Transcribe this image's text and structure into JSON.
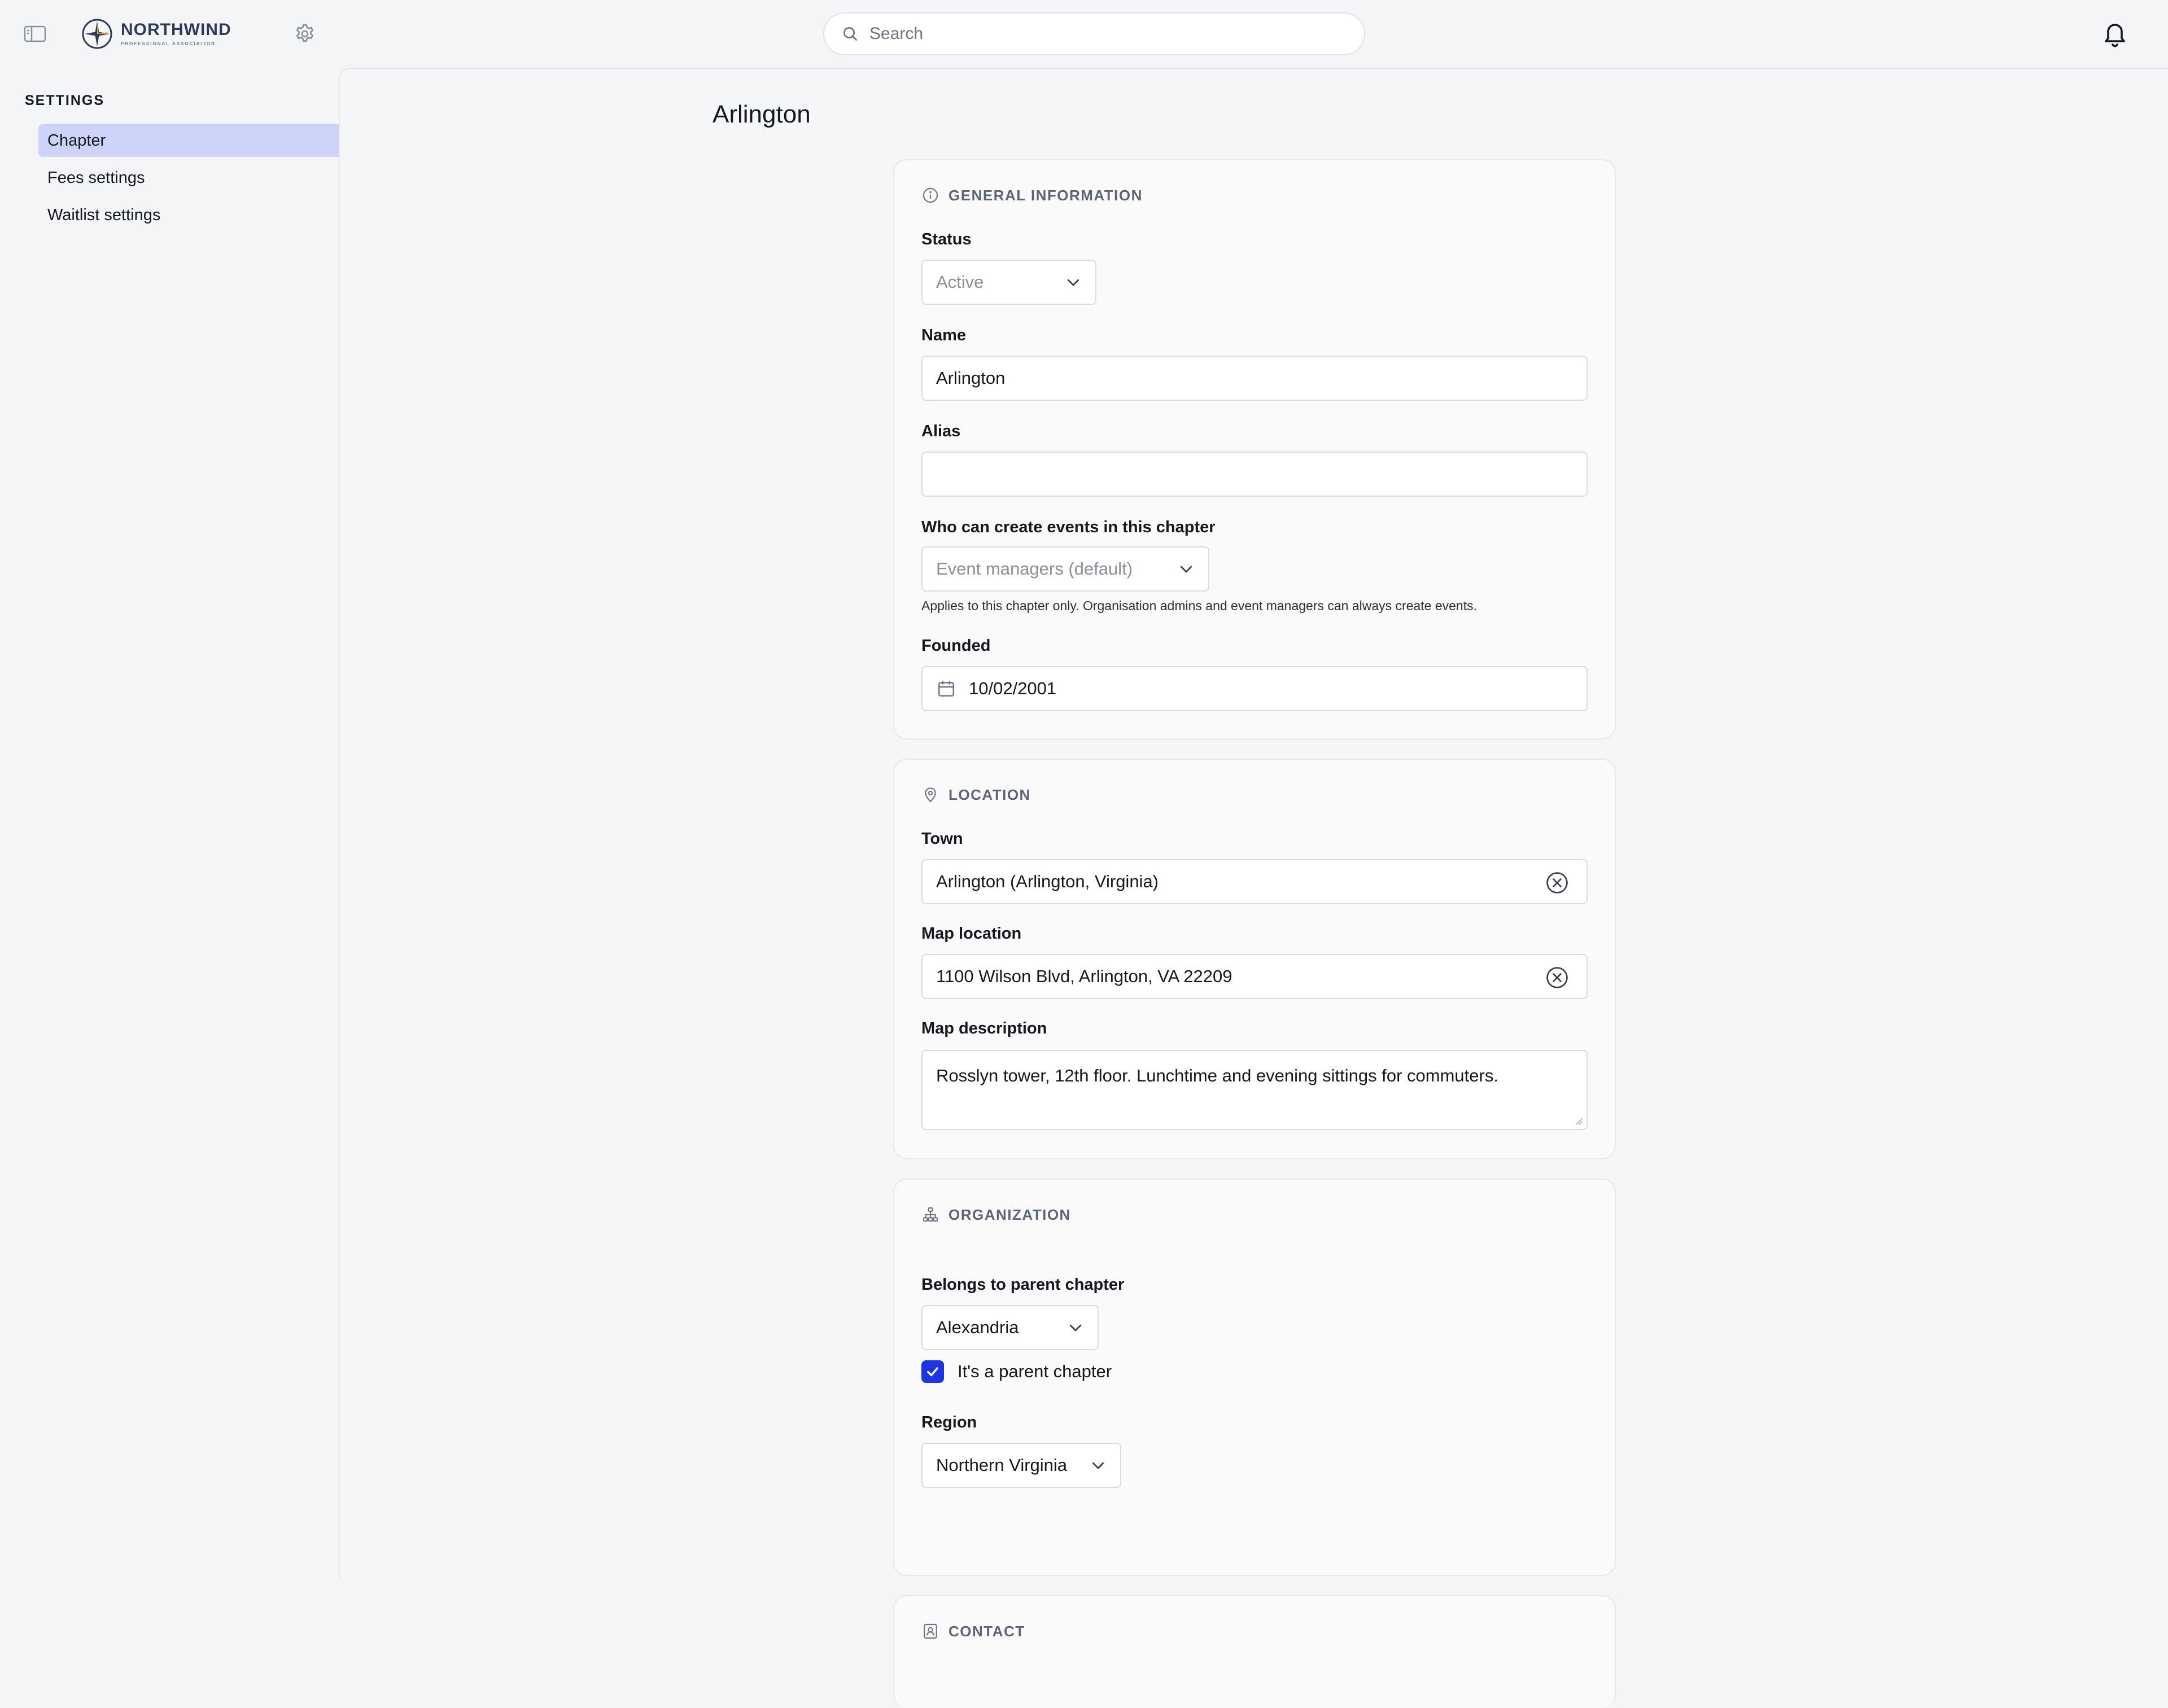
{
  "topbar": {
    "logo_name": "NORTHWIND",
    "logo_sub": "PROFESSIONAL ASSOCIATION",
    "search_placeholder": "Search"
  },
  "sidebar": {
    "heading": "SETTINGS",
    "items": [
      {
        "label": "Chapter",
        "active": true
      },
      {
        "label": "Fees settings",
        "active": false
      },
      {
        "label": "Waitlist settings",
        "active": false
      }
    ]
  },
  "page": {
    "title": "Arlington"
  },
  "general": {
    "heading": "GENERAL INFORMATION",
    "status_label": "Status",
    "status_value": "Active",
    "name_label": "Name",
    "name_value": "Arlington",
    "alias_label": "Alias",
    "alias_value": "",
    "who_label": "Who can create events in this chapter",
    "who_value": "Event managers (default)",
    "who_help": "Applies to this chapter only. Organisation admins and event managers can always create events.",
    "founded_label": "Founded",
    "founded_value": "10/02/2001"
  },
  "location": {
    "heading": "LOCATION",
    "town_label": "Town",
    "town_value": "Arlington (Arlington, Virginia)",
    "map_location_label": "Map location",
    "map_location_value": "1100 Wilson Blvd, Arlington, VA 22209",
    "map_description_label": "Map description",
    "map_description_value": "Rosslyn tower, 12th floor. Lunchtime and evening sittings for commuters."
  },
  "organization": {
    "heading": "ORGANIZATION",
    "parent_label": "Belongs to parent chapter",
    "parent_value": "Alexandria",
    "is_parent_label": "It's a parent chapter",
    "is_parent_checked": true,
    "region_label": "Region",
    "region_value": "Northern Virginia"
  },
  "contact": {
    "heading": "CONTACT"
  },
  "colors": {
    "accent": "#1d35e6",
    "active_nav": "#cdd3f8",
    "background": "#f4f5f7",
    "card": "#fafafa"
  }
}
